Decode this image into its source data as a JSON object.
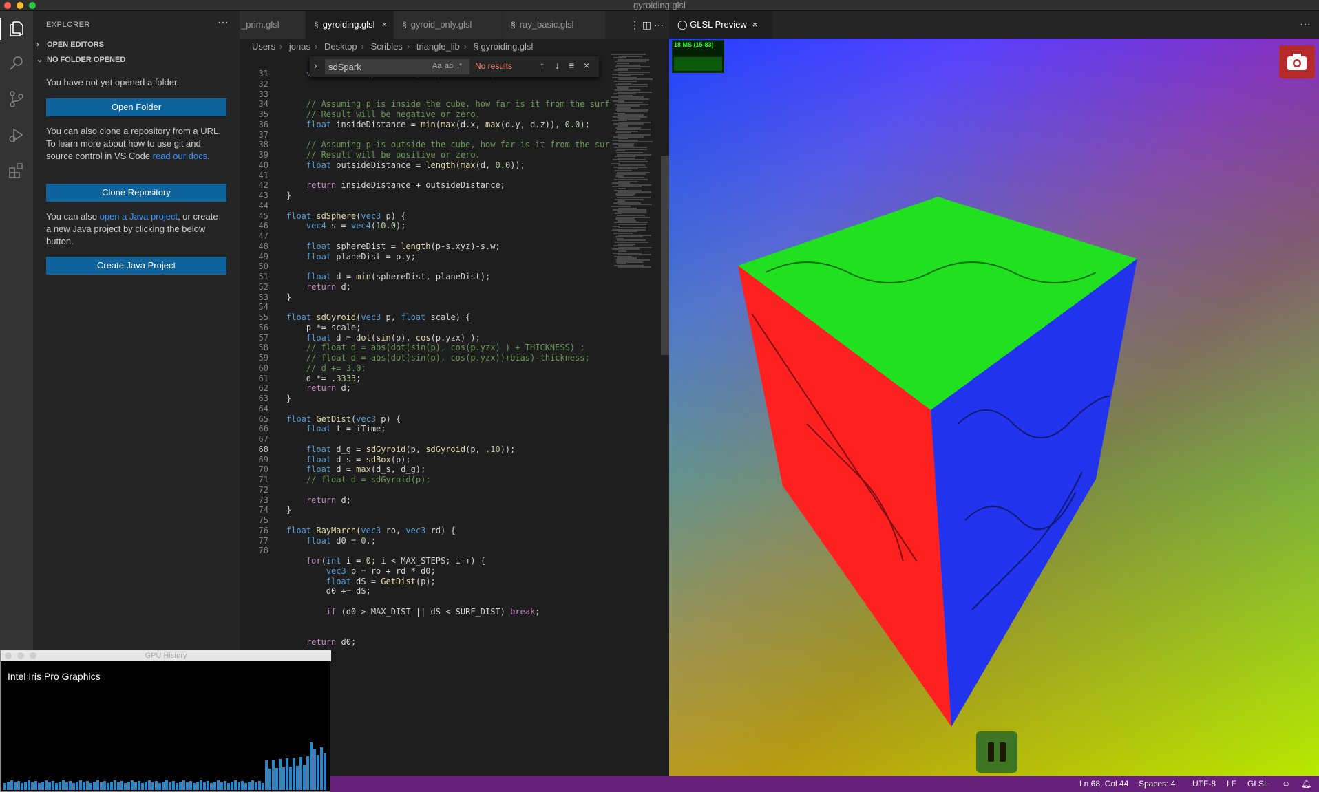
{
  "window": {
    "title": "gyroiding.glsl"
  },
  "explorer": {
    "title": "EXPLORER",
    "more": "···",
    "open_editors": "OPEN EDITORS",
    "no_folder": "NO FOLDER OPENED",
    "msg1": "You have not yet opened a folder.",
    "open_folder": "Open Folder",
    "msg2a": "You can also clone a repository from a URL. To learn more about how to use git and source control in VS Code ",
    "msg2_link": "read our docs",
    "msg2b": ".",
    "clone_repo": "Clone Repository",
    "msg3a": "You can also ",
    "msg3_link": "open a Java project",
    "msg3b": ", or create a new Java project by clicking the below button.",
    "create_java": "Create Java Project"
  },
  "tabs": [
    {
      "label": "_prim.glsl"
    },
    {
      "label": "gyroiding.glsl",
      "active": true
    },
    {
      "label": "gyroid_only.glsl"
    },
    {
      "label": "ray_basic.glsl"
    }
  ],
  "tab_actions": "⋮  ◫  ···",
  "breadcrumb": [
    "Users",
    "jonas",
    "Desktop",
    "Scribles",
    "triangle_lib",
    "gyroiding.glsl"
  ],
  "find": {
    "value": "sdSpark",
    "case": "Aa",
    "word": "ab",
    "regex": ".*",
    "result": "No results"
  },
  "code": [
    {
      "n": "31",
      "t": "    vec3 d = abs(p - trans) - (size / 2.0);"
    },
    {
      "n": "32",
      "t": ""
    },
    {
      "n": "33",
      "t": ""
    },
    {
      "n": "34",
      "t": "    // Assuming p is inside the cube, how far is it from the surf"
    },
    {
      "n": "35",
      "t": "    // Result will be negative or zero."
    },
    {
      "n": "36",
      "t": "    float insideDistance = min(max(d.x, max(d.y, d.z)), 0.0);"
    },
    {
      "n": "37",
      "t": ""
    },
    {
      "n": "38",
      "t": "    // Assuming p is outside the cube, how far is it from the sur"
    },
    {
      "n": "39",
      "t": "    // Result will be positive or zero."
    },
    {
      "n": "40",
      "t": "    float outsideDistance = length(max(d, 0.0));"
    },
    {
      "n": "41",
      "t": ""
    },
    {
      "n": "42",
      "t": "    return insideDistance + outsideDistance;"
    },
    {
      "n": "43",
      "t": "}"
    },
    {
      "n": "44",
      "t": ""
    },
    {
      "n": "45",
      "t": "float sdSphere(vec3 p) {"
    },
    {
      "n": "46",
      "t": "    vec4 s = vec4(10.0);"
    },
    {
      "n": "47",
      "t": ""
    },
    {
      "n": "48",
      "t": "    float sphereDist = length(p-s.xyz)-s.w;"
    },
    {
      "n": "49",
      "t": "    float planeDist = p.y;"
    },
    {
      "n": "50",
      "t": ""
    },
    {
      "n": "51",
      "t": "    float d = min(sphereDist, planeDist);"
    },
    {
      "n": "52",
      "t": "    return d;"
    },
    {
      "n": "53",
      "t": "}"
    },
    {
      "n": "54",
      "t": ""
    },
    {
      "n": "55",
      "t": "float sdGyroid(vec3 p, float scale) {"
    },
    {
      "n": "56",
      "t": "    p *= scale;"
    },
    {
      "n": "57",
      "t": "    float d = dot(sin(p), cos(p.yzx) );"
    },
    {
      "n": "58",
      "t": "    // float d = abs(dot(sin(p), cos(p.yzx) ) + THICKNESS) ;"
    },
    {
      "n": "59",
      "t": "    // float d = abs(dot(sin(p), cos(p.yzx))+bias)-thickness;"
    },
    {
      "n": "60",
      "t": "    // d += 3.0;"
    },
    {
      "n": "61",
      "t": "    d *= .3333;"
    },
    {
      "n": "62",
      "t": "    return d;"
    },
    {
      "n": "63",
      "t": "}"
    },
    {
      "n": "64",
      "t": ""
    },
    {
      "n": "65",
      "t": "float GetDist(vec3 p) {"
    },
    {
      "n": "66",
      "t": "    float t = iTime;"
    },
    {
      "n": "67",
      "t": ""
    },
    {
      "n": "68",
      "t": "    float d_g = sdGyroid(p, sdGyroid(p, .10));",
      "cur": true
    },
    {
      "n": "69",
      "t": "    float d_s = sdBox(p);"
    },
    {
      "n": "70",
      "t": "    float d = max(d_s, d_g);"
    },
    {
      "n": "71",
      "t": "    // float d = sdGyroid(p);"
    },
    {
      "n": "72",
      "t": ""
    },
    {
      "n": "73",
      "t": "    return d;"
    },
    {
      "n": "74",
      "t": "}"
    },
    {
      "n": "75",
      "t": ""
    },
    {
      "n": "76",
      "t": "float RayMarch(vec3 ro, vec3 rd) {"
    },
    {
      "n": "77",
      "t": "    float d0 = 0.;"
    },
    {
      "n": "78",
      "t": ""
    },
    {
      "n": "",
      "t": "    for(int i = 0; i < MAX_STEPS; i++) {"
    },
    {
      "n": "",
      "t": "        vec3 p = ro + rd * d0;"
    },
    {
      "n": "",
      "t": "        float dS = GetDist(p);"
    },
    {
      "n": "",
      "t": "        d0 += dS;"
    },
    {
      "n": "",
      "t": ""
    },
    {
      "n": "",
      "t": "        if (d0 > MAX_DIST || dS < SURF_DIST) break;"
    },
    {
      "n": "",
      "t": ""
    },
    {
      "n": "",
      "t": ""
    },
    {
      "n": "",
      "t": "    return d0;"
    }
  ],
  "preview": {
    "tab": "GLSL Preview",
    "fps": "18 MS (15-83)"
  },
  "gpu": {
    "title": "GPU History",
    "name": "Intel Iris Pro Graphics"
  },
  "status": {
    "position": "Ln 68, Col 44",
    "spaces": "Spaces: 4",
    "encoding": "UTF-8",
    "eol": "LF",
    "language": "GLSL"
  }
}
